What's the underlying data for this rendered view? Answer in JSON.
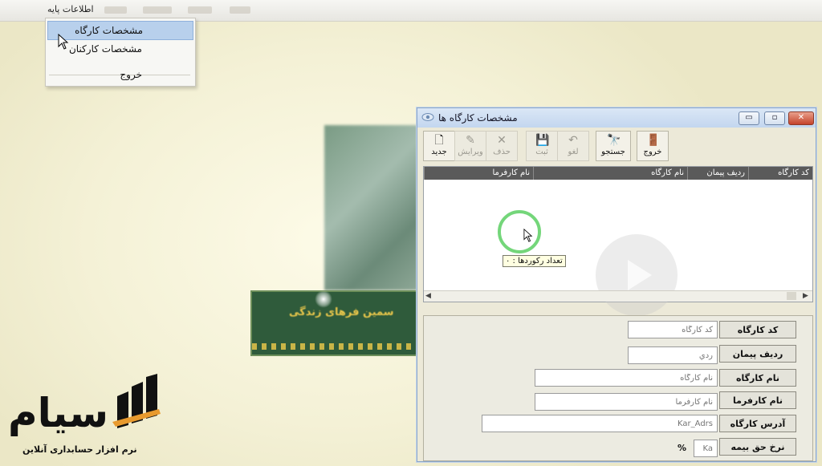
{
  "menubar": {
    "main_menu": "اطلاعات پایه"
  },
  "dropdown": {
    "items": [
      {
        "label": "مشخصات کارگاه"
      },
      {
        "label": "مشخصات کارکنان"
      },
      {
        "label": "خروج"
      }
    ]
  },
  "background": {
    "banner_text": "سمین فرهای زندگی"
  },
  "window": {
    "title": "مشخصات کارگاه ها",
    "buttons": {
      "minimize": "▭",
      "restore": "▫",
      "close": "✕"
    },
    "toolbar": [
      {
        "label": "جدید",
        "icon": "new-doc-icon",
        "glyph": "🗋",
        "enabled": true
      },
      {
        "label": "ویرایش",
        "icon": "edit-icon",
        "glyph": "✎",
        "enabled": false
      },
      {
        "label": "حذف",
        "icon": "delete-icon",
        "glyph": "✕",
        "enabled": false
      },
      {
        "label": "ثبت",
        "icon": "save-icon",
        "glyph": "💾",
        "enabled": false
      },
      {
        "label": "لغو",
        "icon": "undo-icon",
        "glyph": "↶",
        "enabled": false
      },
      {
        "label": "جستجو",
        "icon": "binoculars-icon",
        "glyph": "🔭",
        "enabled": true
      },
      {
        "label": "خروج",
        "icon": "exit-door-icon",
        "glyph": "🚪",
        "enabled": true
      }
    ],
    "grid": {
      "columns": [
        "کد کارگاه",
        "ردیف پیمان",
        "نام کارگاه",
        "نام کارفرما"
      ],
      "tooltip": "تعداد رکوردها : ۰"
    },
    "form": {
      "fields": [
        {
          "label": "کد کارگاه",
          "placeholder": "کد کارگاه"
        },
        {
          "label": "ردیف پیمان",
          "placeholder": "ردي"
        },
        {
          "label": "نام کارگاه",
          "placeholder": "نام کارگاه"
        },
        {
          "label": "نام کارفرما",
          "placeholder": "نام کارفرما"
        },
        {
          "label": "آدرس کارگاه",
          "placeholder": "Kar_Adrs"
        },
        {
          "label": "نرخ حق بیمه",
          "placeholder": "Ka"
        }
      ],
      "percent": "%"
    }
  },
  "logo": {
    "word": "سیام",
    "tagline": "نرم افزار حسابداری آنلاین"
  }
}
